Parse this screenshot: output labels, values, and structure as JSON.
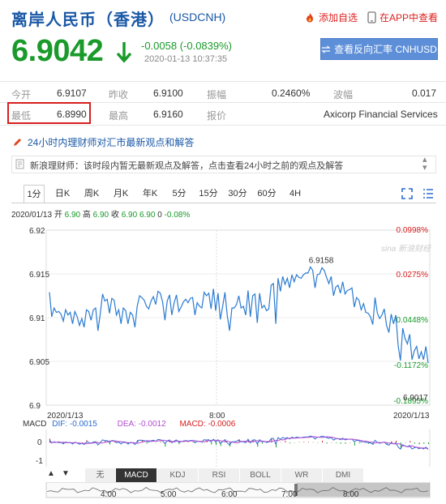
{
  "header": {
    "title": "离岸人民币（香港）",
    "code": "(USDCNH)",
    "add_watch": "添加自选",
    "app_view": "在APP中查看"
  },
  "quote": {
    "price": "6.9042",
    "change": "-0.0058 (-0.0839%)",
    "time": "2020-01-13 10:37:35",
    "reverse_button": "查看反向汇率 CNHUSD"
  },
  "stats": {
    "row1": [
      {
        "label": "今开",
        "value": "6.9107"
      },
      {
        "label": "昨收",
        "value": "6.9100"
      },
      {
        "label": "振幅",
        "value": "0.2460%"
      },
      {
        "label": "波幅",
        "value": "0.017"
      }
    ],
    "row2": [
      {
        "label": "最低",
        "value": "6.8990"
      },
      {
        "label": "最高",
        "value": "6.9160"
      },
      {
        "label": "报价",
        "value": "Axicorp Financial Services"
      }
    ]
  },
  "expert": {
    "heading": "24小时内理财师对汇市最新观点和解答",
    "message": "新浪理财师：该时段内暂无最新观点及解答，点击查看24小时之前的观点及解答"
  },
  "chart_tabs": [
    "1分",
    "日K",
    "周K",
    "月K",
    "年K",
    "5分",
    "15分",
    "30分",
    "60分",
    "4H"
  ],
  "active_tab": "1分",
  "infoline": {
    "date": "2020/01/13",
    "open_lbl": "开",
    "open": "6.90",
    "high_lbl": "高",
    "high": "6.90",
    "close_lbl": "收",
    "close": "6.90",
    "last_lbl": "",
    "last": "6.90",
    "vol": "0",
    "pct": "-0.08%"
  },
  "watermark": "sina 新浪财经",
  "chart_data": {
    "type": "line",
    "x_start_label": "2020/1/13",
    "x_mid_label": "8:00",
    "x_end_label": "2020/1/13",
    "y_left_ticks": [
      "6.92",
      "6.915",
      "6.91",
      "6.905",
      "6.9"
    ],
    "y_right_ticks": [
      "0.0998%",
      "0.0275%",
      "-0.0448%",
      "-0.1172%",
      "-0.1895%"
    ],
    "ylim": [
      6.9,
      6.92
    ],
    "high_label": "6.9158",
    "last_label": "6.9017",
    "series": [
      {
        "values": [
          6.9129,
          6.9101,
          6.9111,
          6.9106,
          6.9107,
          6.9104,
          6.9096,
          6.9109,
          6.9103,
          6.9106,
          6.9093,
          6.9107,
          6.9101,
          6.9091,
          6.9099,
          6.9089,
          6.9109,
          6.9107,
          6.9097,
          6.9109,
          6.9111,
          6.9085,
          6.9104,
          6.9127,
          6.9119,
          6.9121,
          6.9105,
          6.9122,
          6.912,
          6.9103,
          6.9109,
          6.9093,
          6.9111,
          6.9108,
          6.9093,
          6.9106,
          6.9103,
          6.9089,
          6.9113,
          6.9125,
          6.9123,
          6.912,
          6.9113,
          6.911,
          6.9119,
          6.9124,
          6.9115,
          6.913,
          6.9128,
          6.9118,
          6.9097,
          6.9119,
          6.9126,
          6.9103,
          6.9117,
          6.9126,
          6.9107,
          6.9112,
          6.9118,
          6.9121,
          6.9117,
          6.9122,
          6.9123,
          6.9103,
          6.9117,
          6.9113,
          6.9111,
          6.9129,
          6.9125,
          6.9128,
          6.911,
          6.9133,
          6.9108,
          6.9128,
          6.9098,
          6.9113,
          6.9129,
          6.9102,
          6.9085,
          6.9111,
          6.9111,
          6.9115,
          6.9125,
          6.9111,
          6.9113,
          6.9103,
          6.9131,
          6.9101,
          6.9125,
          6.9127,
          6.9094,
          6.9128,
          6.9111,
          6.9114,
          6.9108,
          6.911,
          6.9137,
          6.9139,
          6.9093,
          6.9145,
          6.913,
          6.9147,
          6.9138,
          6.9145,
          6.9134,
          6.9149,
          6.9141,
          6.9149,
          6.9146,
          6.9145,
          6.9149,
          6.9151,
          6.9151,
          6.9158,
          6.9154,
          6.9134,
          6.9149,
          6.915,
          6.9157,
          6.9154,
          6.9146,
          6.9139,
          6.9147,
          6.9125,
          6.9135,
          6.9137,
          6.9128,
          6.9141,
          6.9127,
          6.9131,
          6.9132,
          6.9134,
          6.9112,
          6.9123,
          6.912,
          6.9109,
          6.9116,
          6.9106,
          6.9105,
          6.9101,
          6.9092,
          6.9123,
          6.9105,
          6.9099,
          6.9103,
          6.911,
          6.9091,
          6.9083,
          6.9104,
          6.9093,
          6.9103,
          6.9068,
          6.9051,
          6.9088,
          6.9076,
          6.907,
          6.9081,
          6.9052,
          6.9062,
          6.9067,
          6.9053,
          6.9061,
          6.9052,
          6.9067,
          6.9048
        ]
      }
    ]
  },
  "macd": {
    "label": "MACD",
    "dif": "DIF: -0.0015",
    "dea": "DEA: -0.0012",
    "macd": "MACD: -0.0006",
    "ticks": [
      "0",
      "-1"
    ],
    "colors": {
      "dif": "#2b6cd1",
      "dea": "#b14ed1",
      "macd": "#d61f1f"
    }
  },
  "indicator_tabs": [
    "无",
    "MACD",
    "KDJ",
    "RSI",
    "BOLL",
    "WR",
    "DMI"
  ],
  "active_indicator": "MACD",
  "timeline": [
    "4:00",
    "5:00",
    "6:00",
    "7:00",
    "8:00"
  ],
  "colors": {
    "up": "#d61f1f",
    "down": "#1a9a2b",
    "line": "#2b7bd1",
    "accent": "#1a58a6"
  }
}
